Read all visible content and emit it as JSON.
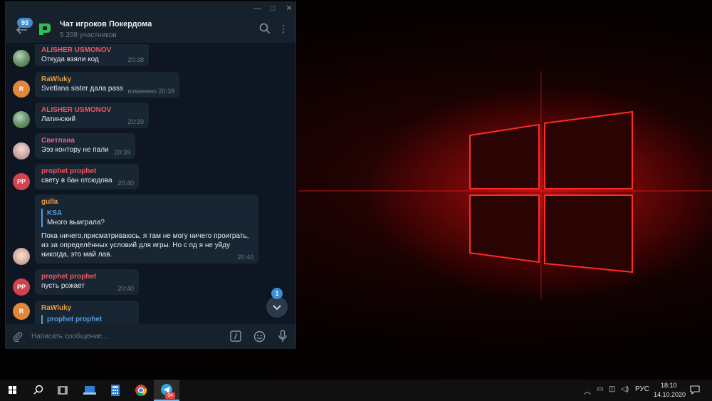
{
  "window": {
    "title_badge": "93",
    "chat_title": "Чат игроков Покердома",
    "chat_subtitle": "5 208 участников",
    "icons": [
      "minimize-icon",
      "maximize-icon",
      "close-icon",
      "back-arrow-icon",
      "search-icon",
      "more-vertical-icon"
    ]
  },
  "messages": [
    {
      "sender": "ALISHER USMONOV",
      "text": "Откуда взяли код",
      "time": "20:38",
      "avatar": ""
    },
    {
      "sender": "RaWluky",
      "text": "Svetlana sister дала pass",
      "time": "изменено 20:39",
      "avatar": "R"
    },
    {
      "sender": "ALISHER USMONOV",
      "text": "Латинский",
      "time": "20:39",
      "avatar": ""
    },
    {
      "sender": "Светлана",
      "text": "Ээз контору не пали",
      "time": "20:39",
      "avatar": ""
    },
    {
      "sender": "prophet prophet",
      "text": "свету в бан отсюдова",
      "time": "20:40",
      "avatar": "PP"
    },
    {
      "sender": "gulla",
      "quote_name": "KSA",
      "quote_text": "Много выиграла?",
      "lines": [
        "Пока ничего,присматриваюсь, я там не могу ничего проиграть,",
        "из за определённых условий для игры. Но с пд я не уйду",
        "никогда, это май лав."
      ],
      "time": "20:40",
      "avatar": ""
    },
    {
      "sender": "prophet prophet",
      "text": "пусть рожает",
      "time": "20:40",
      "avatar": "PP"
    },
    {
      "sender": "RaWluky",
      "quote_name": "prophet prophet",
      "avatar": "R"
    }
  ],
  "scroll_badge": "1",
  "composer": {
    "placeholder": "Написать сообщение...",
    "icons": [
      "attach-icon",
      "bot-command-icon",
      "emoji-icon",
      "microphone-icon"
    ]
  },
  "taskbar": {
    "apps": [
      "windows-start-icon",
      "search-icon",
      "task-view-icon",
      "file-manager-icon",
      "calculator-icon",
      "chrome-icon",
      "telegram-icon"
    ],
    "telegram_badge": "94",
    "tray_lang": "РУС",
    "time": "18:10",
    "date": "14.10.2020"
  },
  "colors": {
    "window_bg": "#0e1621",
    "bubble": "#182533",
    "accent": "#3e8ed0",
    "name_red": "#f0575e",
    "name_orange": "#e89c43",
    "name_pink": "#e35f9a"
  }
}
